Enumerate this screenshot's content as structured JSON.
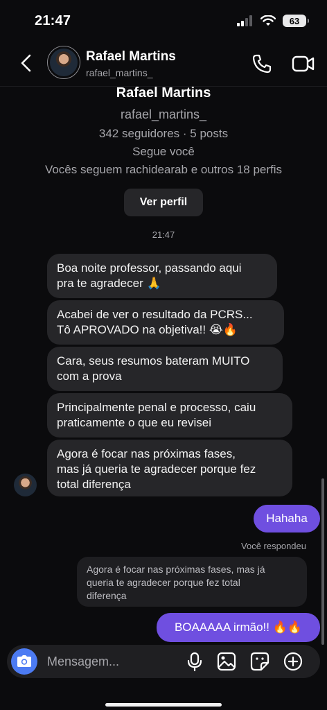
{
  "status_bar": {
    "time": "21:47",
    "battery": "63"
  },
  "header": {
    "name": "Rafael Martins",
    "username": "rafael_martins_"
  },
  "profile_card": {
    "name": "Rafael Martins",
    "username": "rafael_martins_",
    "stats": "342 seguidores · 5 posts",
    "follows_you": "Segue você",
    "mutual": "Vocês seguem rachidearab e outros 18 perfis",
    "view_profile_label": "Ver perfil"
  },
  "timestamp": "21:47",
  "incoming_messages": [
    {
      "line1": "Boa noite professor, passando aqui",
      "line2": "pra te agradecer 🙏"
    },
    {
      "line1": "Acabei de ver o resultado da PCRS...",
      "line2": "Tô APROVADO na objetiva!! 😭🔥"
    },
    {
      "line1": "Cara, seus resumos bateram MUITO",
      "line2": "com a prova"
    },
    {
      "line1": "Principalmente penal e processo, caiu",
      "line2": "praticamente o que eu revisei"
    },
    {
      "line1": "Agora é focar nas próximas fases,",
      "line2": "mas já queria te agradecer porque fez",
      "line3": "total diferença"
    }
  ],
  "outgoing_messages": [
    {
      "text": "Hahaha"
    },
    {
      "text": "BOAAAAA irmão!! 🔥🔥"
    }
  ],
  "reply": {
    "label": "Você respondeu",
    "quoted_line1": "Agora é focar nas próximas fases, mas já",
    "quoted_line2": "queria te agradecer porque fez total",
    "quoted_line3": "diferença"
  },
  "composer": {
    "placeholder": "Mensagem..."
  },
  "colors": {
    "background": "#0b0b0d",
    "incoming_bubble": "#262629",
    "outgoing_bubble": "#6f4fe0",
    "camera_button": "#4c7bf3"
  }
}
